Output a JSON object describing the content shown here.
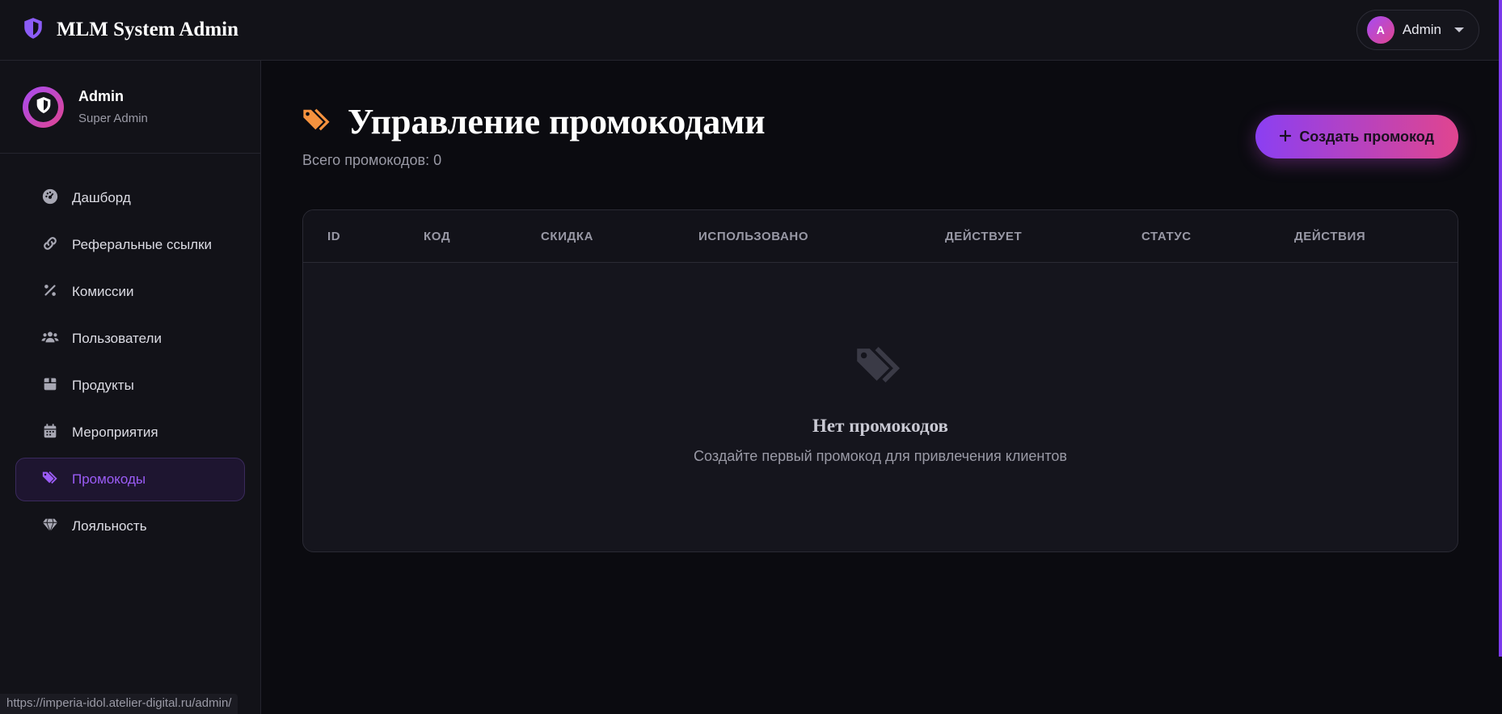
{
  "app": {
    "title": "MLM System Admin"
  },
  "topbar": {
    "user_initial": "A",
    "user_name": "Admin"
  },
  "sidebar": {
    "profile": {
      "name": "Admin",
      "role": "Super Admin"
    },
    "items": [
      {
        "label": "Дашборд",
        "icon": "dashboard-icon"
      },
      {
        "label": "Реферальные ссылки",
        "icon": "link-icon"
      },
      {
        "label": "Комиссии",
        "icon": "percent-icon"
      },
      {
        "label": "Пользователи",
        "icon": "users-icon"
      },
      {
        "label": "Продукты",
        "icon": "box-icon"
      },
      {
        "label": "Мероприятия",
        "icon": "calendar-icon"
      },
      {
        "label": "Промокоды",
        "icon": "tags-icon",
        "active": true
      },
      {
        "label": "Лояльность",
        "icon": "gem-icon"
      }
    ]
  },
  "status_url": "https://imperia-idol.atelier-digital.ru/admin/",
  "main": {
    "title": "Управление промокодами",
    "subtitle": "Всего промокодов: 0",
    "create_button": "Создать промокод",
    "table": {
      "columns": [
        "ID",
        "КОД",
        "СКИДКА",
        "ИСПОЛЬЗОВАНО",
        "ДЕЙСТВУЕТ",
        "СТАТУС",
        "ДЕЙСТВИЯ"
      ],
      "empty_title": "Нет промокодов",
      "empty_text": "Создайте первый промокод для привлечения клиентов"
    }
  },
  "colors": {
    "accent": "#9b5cf6",
    "gradient_start": "#8b3ff2",
    "gradient_end": "#e0458f",
    "title_icon": "#f5923e"
  }
}
